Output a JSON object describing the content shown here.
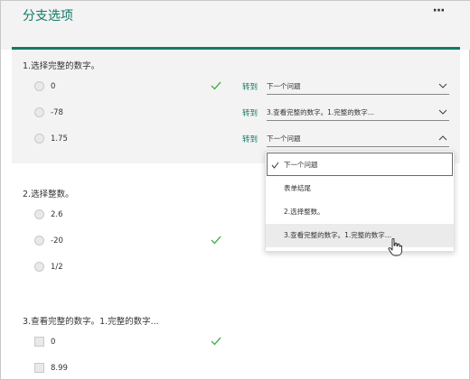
{
  "header": {
    "title": "分支选项",
    "more_label": "···"
  },
  "q1": {
    "title": "1.选择完整的数字。",
    "options": [
      {
        "label": "0",
        "correct": true,
        "goto_label": "转到",
        "goto_value": "下一个问题"
      },
      {
        "label": "-78",
        "correct": false,
        "goto_label": "转到",
        "goto_value": "3.查看完整的数字。1.完整的数字..."
      },
      {
        "label": "1.75",
        "correct": false,
        "goto_label": "转到",
        "goto_value": "下一个问题"
      }
    ]
  },
  "dropdown": {
    "items": [
      {
        "label": "下一个问题",
        "selected": true
      },
      {
        "label": "表单结尾",
        "selected": false
      },
      {
        "label": "2.选择整数。",
        "selected": false
      },
      {
        "label": "3.查看完整的数字。1.完整的数字...",
        "selected": false,
        "hover": true
      }
    ]
  },
  "q2": {
    "title": "2.选择整数。",
    "options": [
      {
        "label": "2.6",
        "correct": false
      },
      {
        "label": "-20",
        "correct": true
      },
      {
        "label": "1/2",
        "correct": false
      }
    ]
  },
  "q3": {
    "title": "3.查看完整的数字。1.完整的数字...",
    "options": [
      {
        "label": "0",
        "correct": true
      },
      {
        "label": "8.99",
        "correct": false
      }
    ]
  },
  "colors": {
    "accent": "#107c62",
    "check": "#4caf50",
    "panel_bg": "#f3f3f3"
  },
  "icons": {
    "correct": "checkmark-icon",
    "chevron_down": "chevron-down-icon",
    "chevron_up": "chevron-up-icon",
    "pointer": "hand-pointer-icon"
  }
}
